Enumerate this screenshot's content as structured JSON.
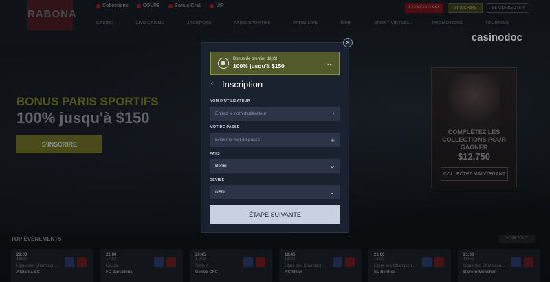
{
  "background": {
    "logo": "RABONA",
    "topnav": [
      "Collections",
      "COUPE",
      "Bonus Crab",
      "VIP"
    ],
    "top_right": [
      "XXXXXXX XXXX",
      "S'INSCRIRE",
      "SE CONNECTER"
    ],
    "mainnav": [
      "CASINO",
      "LIVE CASINO",
      "JACKPOTS",
      "PARIS SPORTIFS",
      "PARIS LIVE",
      "TURF",
      "SPORT VIRTUEL",
      "PROMOTIONS",
      "TOURNOIS"
    ],
    "watermark": "casinodoc",
    "hero_title": "BONUS PARIS SPORTIFS",
    "hero_sub": "100% jusqu'à $150",
    "hero_button": "S'INSCRIRE",
    "promo_text": "COMPLÉTEZ LES COLLECTIONS POUR GAGNER",
    "promo_amount": "$12,750",
    "promo_button": "COLLECTEZ MAINTENANT",
    "top_events_title": "TOP ÉVÉNEMENTS",
    "voir_tout": "VOIR TOUT",
    "events": [
      {
        "time": "21:00",
        "date": "18/02",
        "league": "Ligue des Champion...",
        "team": "Atalanta BC"
      },
      {
        "time": "21:00",
        "date": "17/02",
        "league": "LaLiga",
        "team": "FC Barcelona"
      },
      {
        "time": "20:45",
        "date": "17/02",
        "league": "Serie A",
        "team": "Genoa CFC"
      },
      {
        "time": "18:45",
        "date": "18/02",
        "league": "Ligue des Champion...",
        "team": "AC Milan"
      },
      {
        "time": "21:00",
        "date": "18/02",
        "league": "Ligue des Champion...",
        "team": "SL Benfica"
      },
      {
        "time": "21:00",
        "date": "18/02",
        "league": "Ligue des Champion...",
        "team": "Bayern München"
      }
    ]
  },
  "modal": {
    "bonus": {
      "label": "Bonus de premier dépôt",
      "value": "100% jusqu'à $150"
    },
    "title": "Inscription",
    "username": {
      "label": "NOM D'UTILISATEUR",
      "placeholder": "Entrez le nom d'utilisateur"
    },
    "password": {
      "label": "MOT DE PASSE",
      "placeholder": "Entrer le mot de passe"
    },
    "country": {
      "label": "PAYS",
      "value": "Benin"
    },
    "currency": {
      "label": "DEVISE",
      "value": "USD"
    },
    "submit_label": "ÉTAPE SUIVANTE"
  }
}
